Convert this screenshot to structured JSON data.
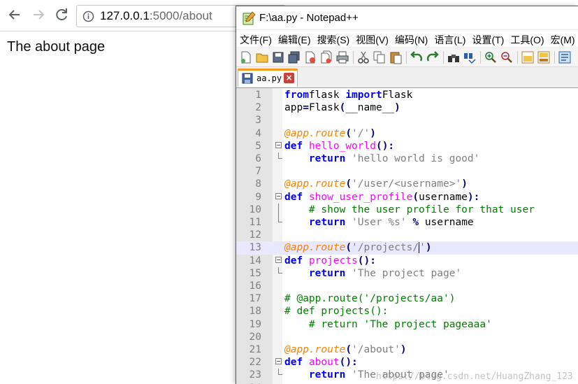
{
  "browser": {
    "url_host": "127.0.0.1",
    "url_path": ":5000/about",
    "page_text": "The about page"
  },
  "npp": {
    "title": "F:\\aa.py - Notepad++",
    "menu": [
      "文件(F)",
      "编辑(E)",
      "搜索(S)",
      "视图(V)",
      "编码(N)",
      "语言(L)",
      "设置(T)",
      "工具(O)",
      "宏(M)"
    ],
    "tab_label": "aa.py",
    "caret_line": 13
  },
  "code_lines": [
    [
      [
        "kw",
        "from"
      ],
      [
        "",
        "flask "
      ],
      [
        "kw",
        "import"
      ],
      [
        "",
        "Flask"
      ]
    ],
    [
      [
        "",
        "app"
      ],
      [
        "op",
        "="
      ],
      [
        "",
        "Flask"
      ],
      [
        "op",
        "("
      ],
      [
        "",
        "__name__"
      ],
      [
        "op",
        ")"
      ]
    ],
    [],
    [
      [
        "dec",
        "@app.route"
      ],
      [
        "op",
        "("
      ],
      [
        "st",
        "'/'"
      ],
      [
        "op",
        ")"
      ]
    ],
    [
      [
        "kw",
        "def"
      ],
      [
        "",
        " "
      ],
      [
        "fn",
        "hello_world"
      ],
      [
        "op",
        "():"
      ]
    ],
    [
      [
        "",
        "    "
      ],
      [
        "kw",
        "return"
      ],
      [
        "",
        " "
      ],
      [
        "st",
        "'hello world is good'"
      ]
    ],
    [],
    [
      [
        "dec",
        "@app.route"
      ],
      [
        "op",
        "("
      ],
      [
        "st",
        "'/user/<username>'"
      ],
      [
        "op",
        ")"
      ]
    ],
    [
      [
        "kw",
        "def"
      ],
      [
        "",
        " "
      ],
      [
        "fn",
        "show_user_profile"
      ],
      [
        "op",
        "("
      ],
      [
        "",
        "username"
      ],
      [
        "op",
        "):"
      ]
    ],
    [
      [
        "",
        "    "
      ],
      [
        "cm",
        "# show the user profile for that user"
      ]
    ],
    [
      [
        "",
        "    "
      ],
      [
        "kw",
        "return"
      ],
      [
        "",
        " "
      ],
      [
        "st",
        "'User %s'"
      ],
      [
        "",
        " "
      ],
      [
        "op",
        "%"
      ],
      [
        "",
        " username"
      ]
    ],
    [],
    [
      [
        "dec",
        "@app.route"
      ],
      [
        "op",
        "("
      ],
      [
        "st",
        "'/projects/"
      ],
      [
        "caret",
        ""
      ],
      [
        "st",
        "'"
      ],
      [
        "op",
        ")"
      ]
    ],
    [
      [
        "kw",
        "def"
      ],
      [
        "",
        " "
      ],
      [
        "fn",
        "projects"
      ],
      [
        "op",
        "():"
      ]
    ],
    [
      [
        "",
        "    "
      ],
      [
        "kw",
        "return"
      ],
      [
        "",
        " "
      ],
      [
        "st",
        "'The project page'"
      ]
    ],
    [],
    [
      [
        "cm",
        "# @app.route('/projects/aa')"
      ]
    ],
    [
      [
        "cm",
        "# def projects():"
      ]
    ],
    [
      [
        "",
        "    "
      ],
      [
        "cm",
        "# return 'The project pageaaa'"
      ]
    ],
    [],
    [
      [
        "dec",
        "@app.route"
      ],
      [
        "op",
        "("
      ],
      [
        "st",
        "'/about'"
      ],
      [
        "op",
        ")"
      ]
    ],
    [
      [
        "kw",
        "def"
      ],
      [
        "",
        " "
      ],
      [
        "fn",
        "about"
      ],
      [
        "op",
        "():"
      ]
    ],
    [
      [
        "",
        "    "
      ],
      [
        "kw",
        "return"
      ],
      [
        "",
        " "
      ],
      [
        "st",
        "'The about page'"
      ]
    ],
    []
  ],
  "fold": [
    "",
    "",
    "",
    "",
    "minus",
    "end",
    "",
    "",
    "minus",
    "line",
    "end",
    "",
    "",
    "minus",
    "end",
    "",
    "",
    "",
    "",
    "",
    "",
    "minus",
    "end",
    ""
  ],
  "watermark": "https://blog.csdn.net/HuangZhang_123"
}
